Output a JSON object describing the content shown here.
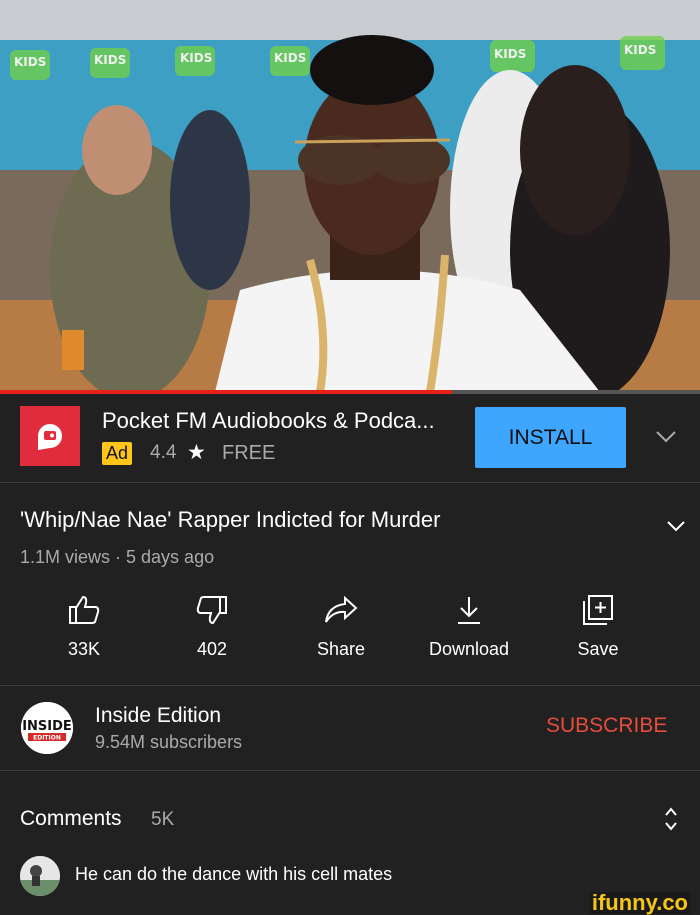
{
  "video": {
    "progress_fraction": 0.645
  },
  "ad": {
    "title": "Pocket FM Audiobooks & Podca...",
    "badge": "Ad",
    "rating": "4.4",
    "star": "★",
    "price": "FREE",
    "install_label": "INSTALL",
    "brand_color": "#e02c3c",
    "button_color": "#3ea6ff"
  },
  "video_info": {
    "title": "'Whip/Nae Nae' Rapper Indicted for Murder",
    "meta": "1.1M views · 5 days ago"
  },
  "actions": [
    {
      "icon": "thumbs-up-icon",
      "label": "33K"
    },
    {
      "icon": "thumbs-down-icon",
      "label": "402"
    },
    {
      "icon": "share-icon",
      "label": "Share"
    },
    {
      "icon": "download-icon",
      "label": "Download"
    },
    {
      "icon": "save-icon",
      "label": "Save"
    }
  ],
  "channel": {
    "name": "Inside Edition",
    "subscribers": "9.54M subscribers",
    "subscribe_label": "SUBSCRIBE",
    "subscribe_color": "#e74c3c",
    "logo_text": "INSIDE",
    "logo_sub": "EDITION"
  },
  "comments": {
    "label": "Comments",
    "count": "5K",
    "top_comment": "He can do the dance with his cell mates"
  },
  "watermark": "ifunny.co"
}
